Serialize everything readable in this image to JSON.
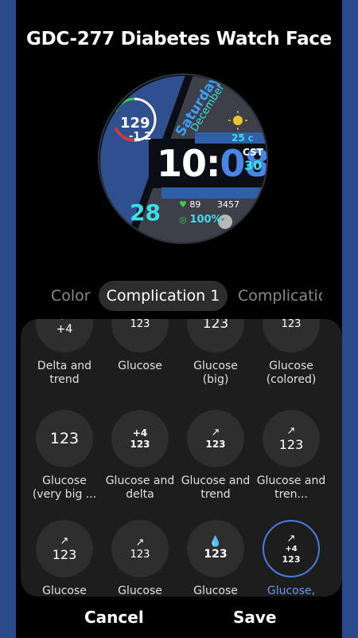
{
  "title": "GDC-277 Diabetes Watch Face",
  "watch": {
    "glucose": "129",
    "delta": "-1.2",
    "day": "Saturday",
    "month": "December",
    "temp": "25",
    "temp_unit": "C",
    "hour": "10",
    "colon": ":",
    "minute": "08",
    "timezone": "CST",
    "seconds": "30",
    "date": "28",
    "heart": "89",
    "steps": "3457",
    "battery": "100%"
  },
  "tabs": [
    "Color",
    "Complication 1",
    "Complicatio"
  ],
  "options": [
    {
      "top": "↗",
      "main": "+4",
      "label": "Delta and trend"
    },
    {
      "top": "",
      "main": "123",
      "label": "Glucose"
    },
    {
      "top": "",
      "main": "123",
      "label": "Glucose (big)"
    },
    {
      "top": "",
      "main": "123",
      "label": "Glucose (colored)"
    },
    {
      "top": "",
      "main": "123",
      "label": "Glucose (very big ..."
    },
    {
      "top": "+4",
      "main": "123",
      "label": "Glucose and delta"
    },
    {
      "top": "↗",
      "main": "123",
      "label": "Glucose and trend"
    },
    {
      "top": "↗",
      "main": "123",
      "label": "Glucose and tren..."
    },
    {
      "top": "↗",
      "main": "123",
      "label": "Glucose"
    },
    {
      "top": "↗",
      "main": "123",
      "label": "Glucose"
    },
    {
      "top": "💧",
      "main": "123",
      "label": "Glucose"
    },
    {
      "top": "↗",
      "mid": "+4",
      "main": "123",
      "label": "Glucose,"
    }
  ],
  "buttons": {
    "cancel": "Cancel",
    "save": "Save"
  },
  "colors": {
    "accent": "#4a7ae0",
    "frame": "#2b4a8c",
    "cyan": "#39e0e6",
    "blue": "#3d7be6"
  }
}
